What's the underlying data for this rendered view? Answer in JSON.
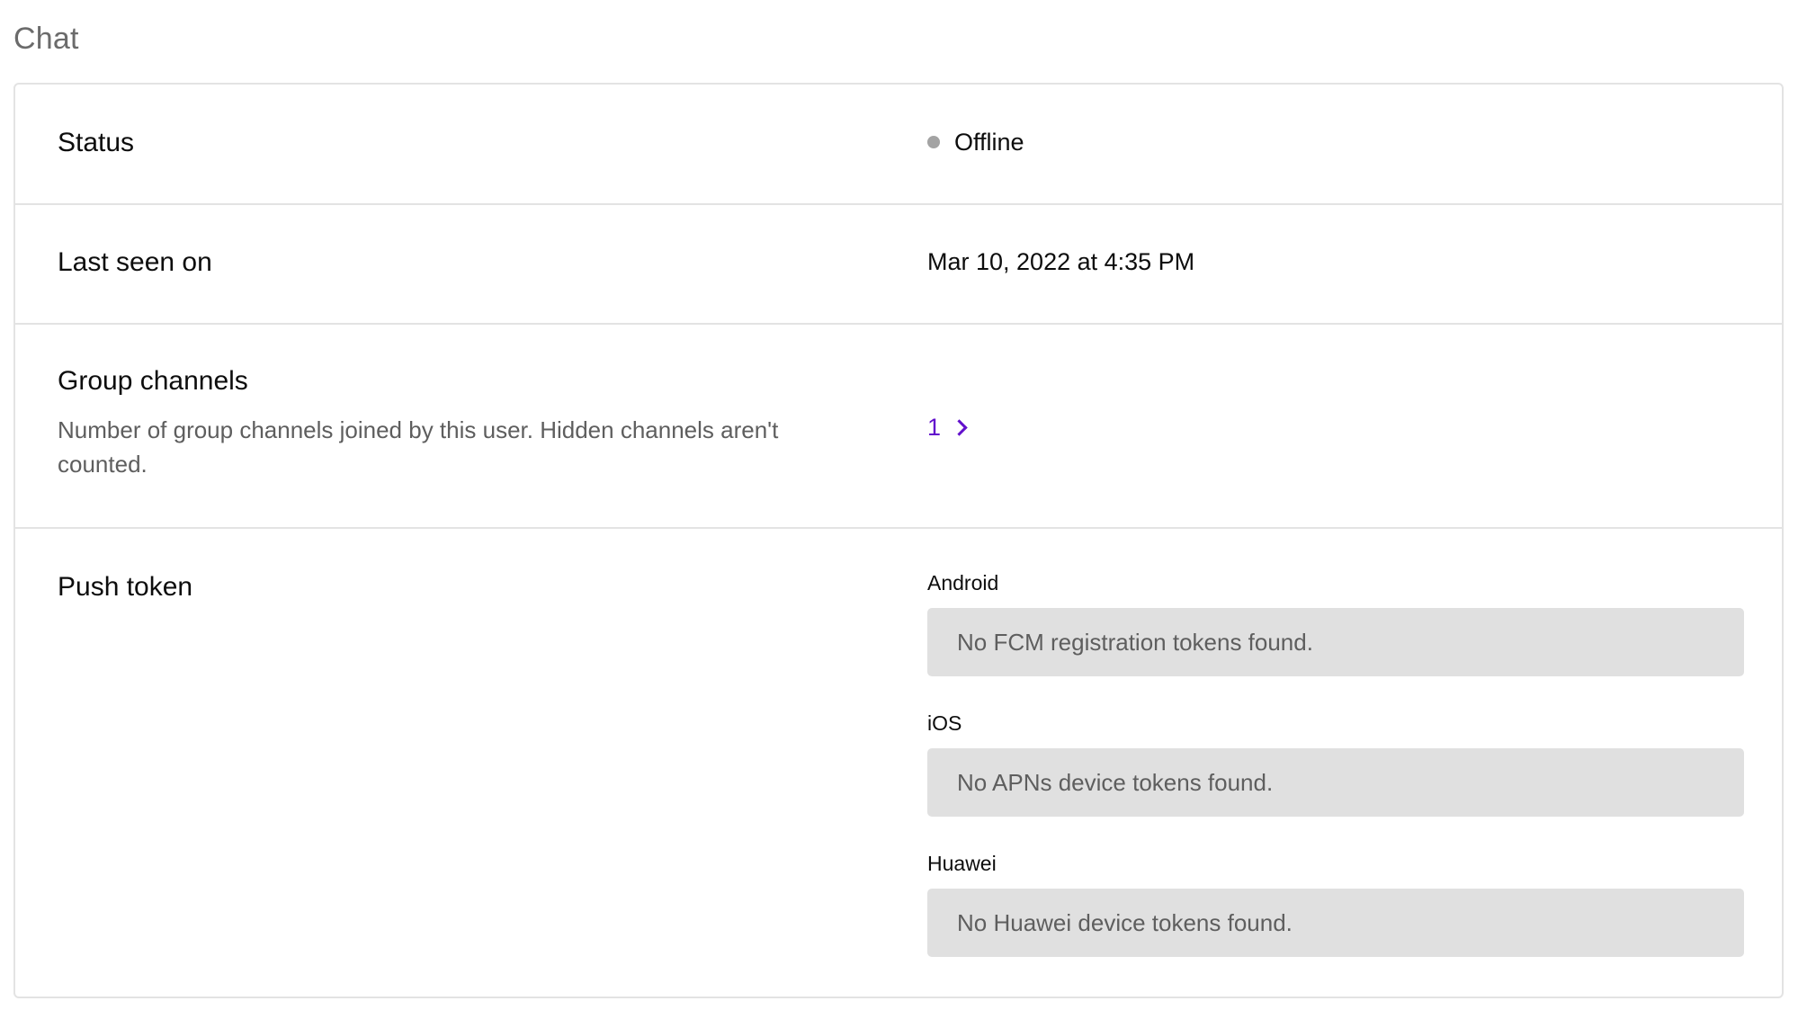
{
  "section": {
    "title": "Chat"
  },
  "rows": {
    "status": {
      "label": "Status",
      "value": "Offline",
      "dot_color": "#a3a3a3"
    },
    "last_seen": {
      "label": "Last seen on",
      "value": "Mar 10, 2022 at 4:35 PM"
    },
    "group_channels": {
      "label": "Group channels",
      "description": "Number of group channels joined by this user. Hidden channels aren't counted.",
      "count": "1",
      "link_color": "#6210cc"
    },
    "push_token": {
      "label": "Push token",
      "android": {
        "label": "Android",
        "value": "No FCM registration tokens found."
      },
      "ios": {
        "label": "iOS",
        "value": "No APNs device tokens found."
      },
      "huawei": {
        "label": "Huawei",
        "value": "No Huawei device tokens found."
      }
    }
  }
}
